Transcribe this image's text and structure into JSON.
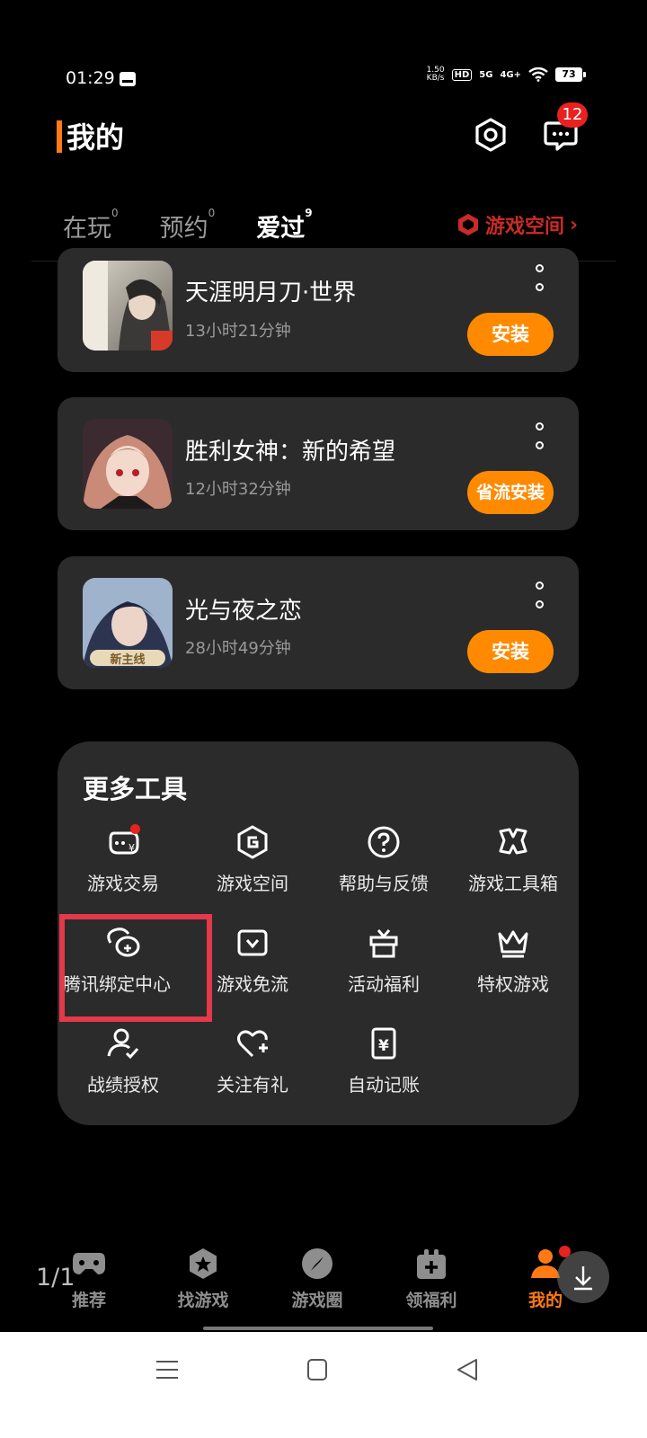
{
  "status_bar": {
    "time": "01:29",
    "speed_top": "1.50",
    "speed_bottom": "KB/s",
    "hd": "HD",
    "net1": "5G",
    "net2": "4G+",
    "battery": "73"
  },
  "header": {
    "title": "我的",
    "message_badge": "12"
  },
  "tabs": [
    {
      "label": "在玩",
      "count": "0"
    },
    {
      "label": "预约",
      "count": "0"
    },
    {
      "label": "爱过",
      "count": "9"
    }
  ],
  "game_space_link": "游戏空间",
  "games": [
    {
      "name": "天涯明月刀·世界",
      "time": "13小时21分钟",
      "button": "安装"
    },
    {
      "name": "胜利女神：新的希望",
      "time": "12小时32分钟",
      "button": "省流安装"
    },
    {
      "name": "光与夜之恋",
      "time": "28小时49分钟",
      "button": "安装",
      "cover_tag": "新主线"
    }
  ],
  "tools": {
    "title": "更多工具",
    "items": [
      {
        "label": "游戏交易",
        "icon": "trade-icon"
      },
      {
        "label": "游戏空间",
        "icon": "game-space-icon"
      },
      {
        "label": "帮助与反馈",
        "icon": "help-icon"
      },
      {
        "label": "游戏工具箱",
        "icon": "toolbox-icon"
      },
      {
        "label": "腾讯绑定中心",
        "icon": "bind-center-icon"
      },
      {
        "label": "游戏免流",
        "icon": "free-data-icon"
      },
      {
        "label": "活动福利",
        "icon": "gift-icon"
      },
      {
        "label": "特权游戏",
        "icon": "crown-icon"
      },
      {
        "label": "战绩授权",
        "icon": "user-check-icon"
      },
      {
        "label": "关注有礼",
        "icon": "heart-plus-icon"
      },
      {
        "label": "自动记账",
        "icon": "ledger-icon"
      }
    ]
  },
  "bottom_nav": [
    {
      "label": "推荐",
      "icon": "gamepad-icon"
    },
    {
      "label": "找游戏",
      "icon": "find-game-icon"
    },
    {
      "label": "游戏圈",
      "icon": "compass-icon"
    },
    {
      "label": "领福利",
      "icon": "welfare-icon"
    },
    {
      "label": "我的",
      "icon": "profile-icon"
    }
  ],
  "page_indicator": "1/1",
  "colors": {
    "accent": "#ff7a14",
    "install_button": "#ff8a00",
    "badge": "#e8221f",
    "card_bg": "#2b2b2b",
    "highlight_box": "#e3394a"
  }
}
